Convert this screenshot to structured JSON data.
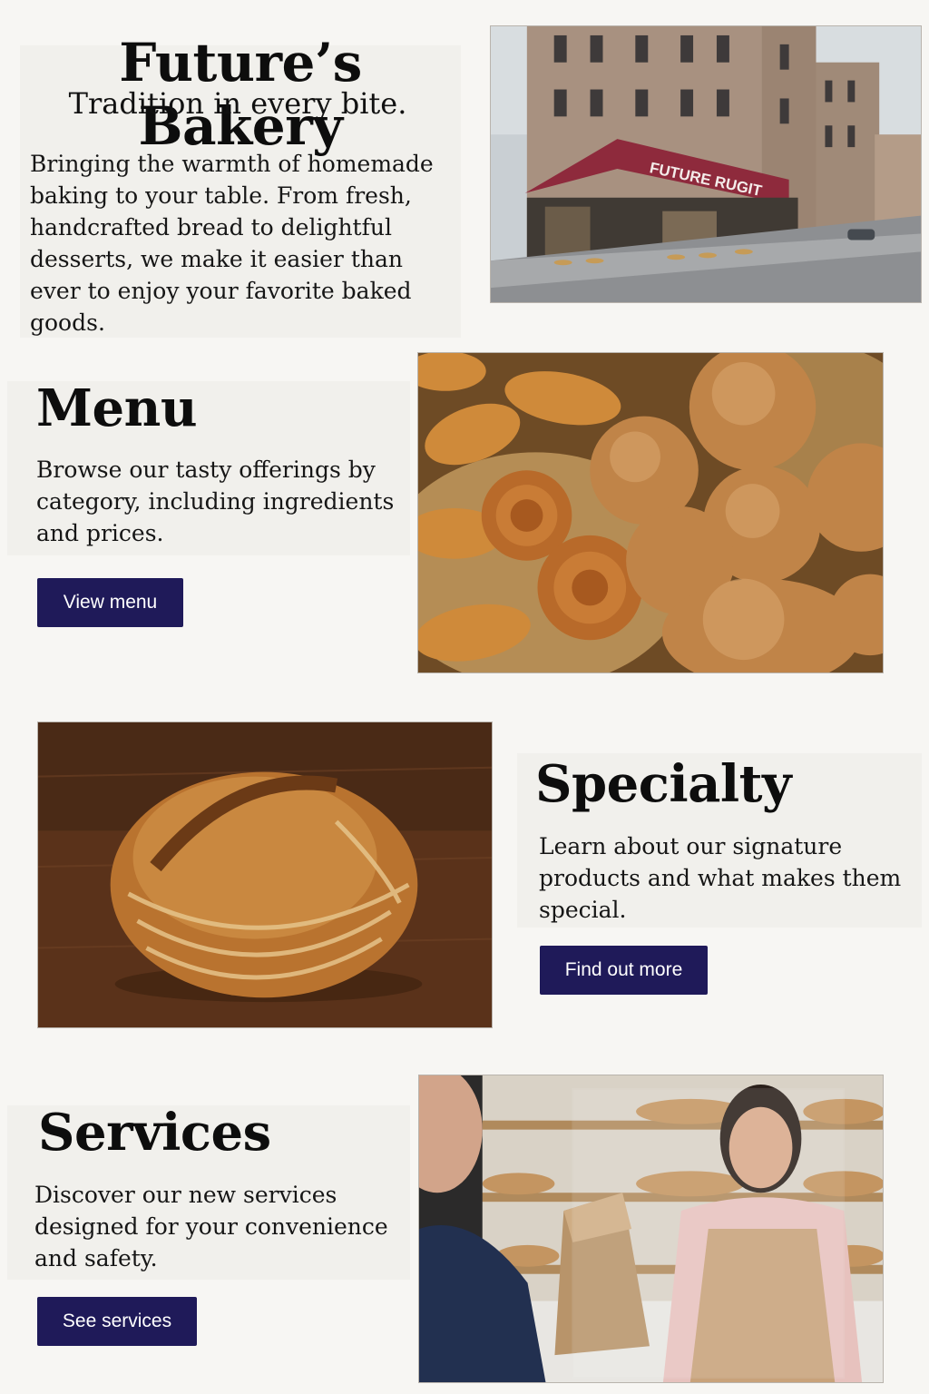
{
  "hero": {
    "title": "Future’s Bakery",
    "tagline": "Tradition in every bite.",
    "description": "Bringing the warmth of homemade baking to your table. From fresh, handcrafted bread to delightful desserts, we make it easier than ever to enjoy your favorite baked goods.",
    "storefront_sign": "FUTURE RUGIT"
  },
  "sections": {
    "menu": {
      "title": "Menu",
      "description": "Browse our tasty offerings by category, including ingredients and prices.",
      "button": "View menu"
    },
    "specialty": {
      "title": "Specialty",
      "description": "Learn about our signature products and what makes them special.",
      "button": "Find out more"
    },
    "services": {
      "title": "Services",
      "description": "Discover our new services designed for your convenience and safety.",
      "button": "See services"
    }
  },
  "colors": {
    "background": "#f7f6f3",
    "panel": "#f1f0ec",
    "button": "#1f1a59",
    "awning": "#8e2a3c"
  }
}
